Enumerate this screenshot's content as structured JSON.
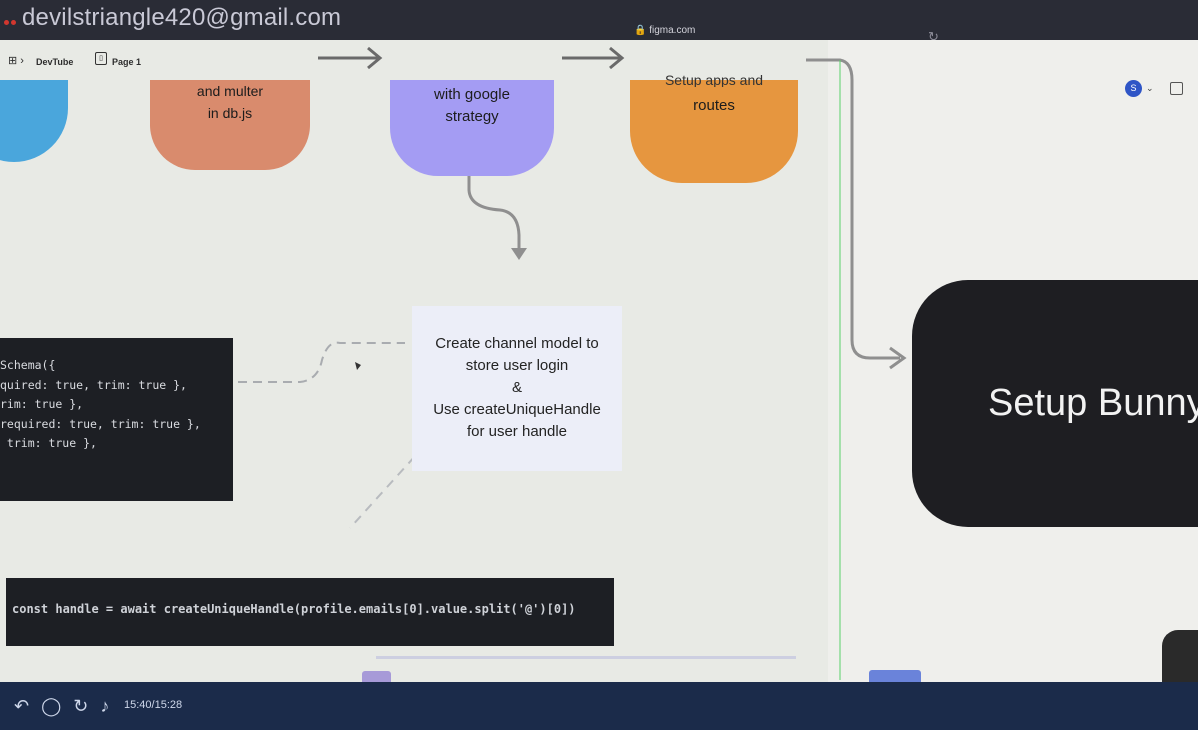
{
  "browser": {
    "account_email": "devilstriangle420@gmail.com",
    "url": "🔒 figma.com",
    "reload_icon": "reload-icon"
  },
  "figma_toolbar": {
    "file_name": "DevTube",
    "page_name": "Page 1",
    "avatar_initial": "S"
  },
  "flow": {
    "node_db_line1": "and multer",
    "node_db_line2": "in db.js",
    "node_google_line1": "with google",
    "node_google_line2": "strategy",
    "node_routes_partial": "Setup apps and",
    "node_routes_line2": "routes",
    "note_channel": [
      "Create channel model to",
      "store user login",
      "&",
      "Use createUniqueHandle",
      "for user handle"
    ],
    "setup_title": "Setup Bunny"
  },
  "code": {
    "schema_lines": [
      "Schema({",
      "quired: true, trim: true },",
      "rim: true },",
      "required: true, trim: true },",
      " trim: true },"
    ],
    "handle_line": "const handle = await createUniqueHandle(profile.emails[0].value.split('@')[0])"
  },
  "taskbar": {
    "time": "15:40/15:28"
  },
  "colors": {
    "node_orange": "#d98b6d",
    "node_purple": "#a49cf3",
    "node_amber": "#e6963f",
    "node_blue": "#4aa6dc",
    "code_bg": "#1d1f24"
  }
}
